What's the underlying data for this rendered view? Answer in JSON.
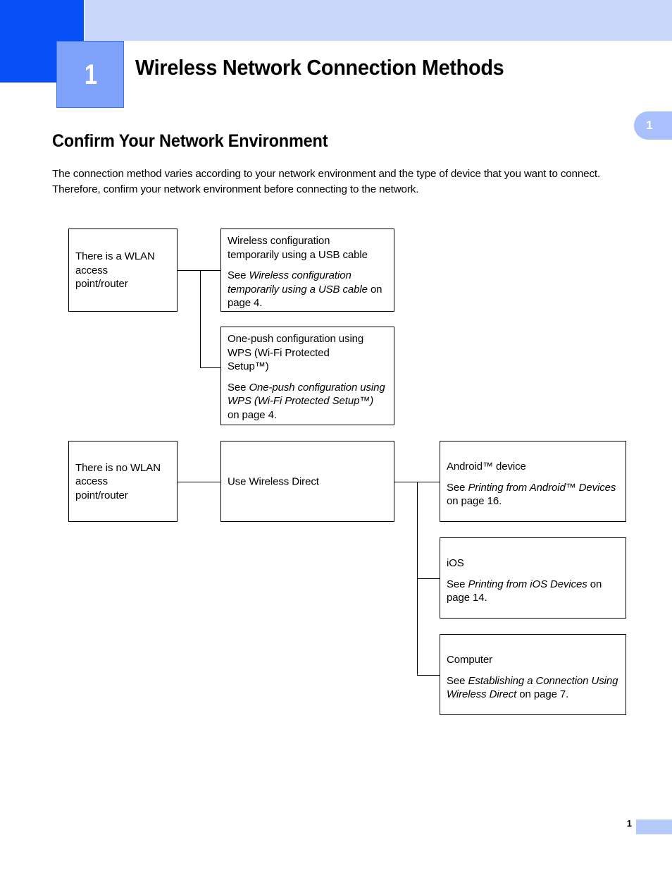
{
  "header": {
    "chapter_number": "1",
    "chapter_title": "Wireless Network Connection Methods",
    "side_tab_number": "1",
    "colors": {
      "dark_block": "#0750f8",
      "light_band": "#c9d7fb",
      "chapter_badge": "#7fa3fb",
      "side_tab": "#a8c0fb",
      "footer_bar": "#b5c9fb"
    }
  },
  "section": {
    "heading": "Confirm Your Network Environment",
    "paragraph": "The connection method varies according to your network environment and the type of device that you want to connect. Therefore, confirm your network environment before connecting to the network."
  },
  "flowchart": {
    "branch_wlan": {
      "condition_label": "There is a WLAN\naccess\npoint/router",
      "condition_line1": "There is a WLAN",
      "condition_line2": "access",
      "condition_line3": "point/router",
      "options": [
        {
          "title_line1": "Wireless configuration",
          "title_line2": "temporarily using a USB cable",
          "ref_prefix": "See ",
          "ref_italic": "Wireless configuration temporarily using a USB cable",
          "ref_suffix": " on page 4."
        },
        {
          "title_line1": "One-push configuration using",
          "title_line2": "WPS (Wi-Fi Protected",
          "title_line3": "Setup™)",
          "ref_prefix": "See ",
          "ref_italic": "One-push configuration using WPS (Wi-Fi Protected Setup™)",
          "ref_suffix": " on page 4."
        }
      ]
    },
    "branch_no_wlan": {
      "condition_line1": "There is no WLAN",
      "condition_line2": "access",
      "condition_line3": "point/router",
      "method_label": "Use Wireless Direct",
      "targets": [
        {
          "title": "Android™ device",
          "ref_prefix": "See ",
          "ref_italic": "Printing from Android™ Devices",
          "ref_suffix": " on page 16."
        },
        {
          "title": "iOS",
          "ref_prefix": "See ",
          "ref_italic": "Printing from iOS Devices",
          "ref_suffix": " on page 14."
        },
        {
          "title": "Computer",
          "ref_prefix": "See ",
          "ref_italic": "Establishing a Connection Using Wireless Direct",
          "ref_suffix": " on page 7."
        }
      ]
    }
  },
  "footer": {
    "page_number": "1"
  }
}
